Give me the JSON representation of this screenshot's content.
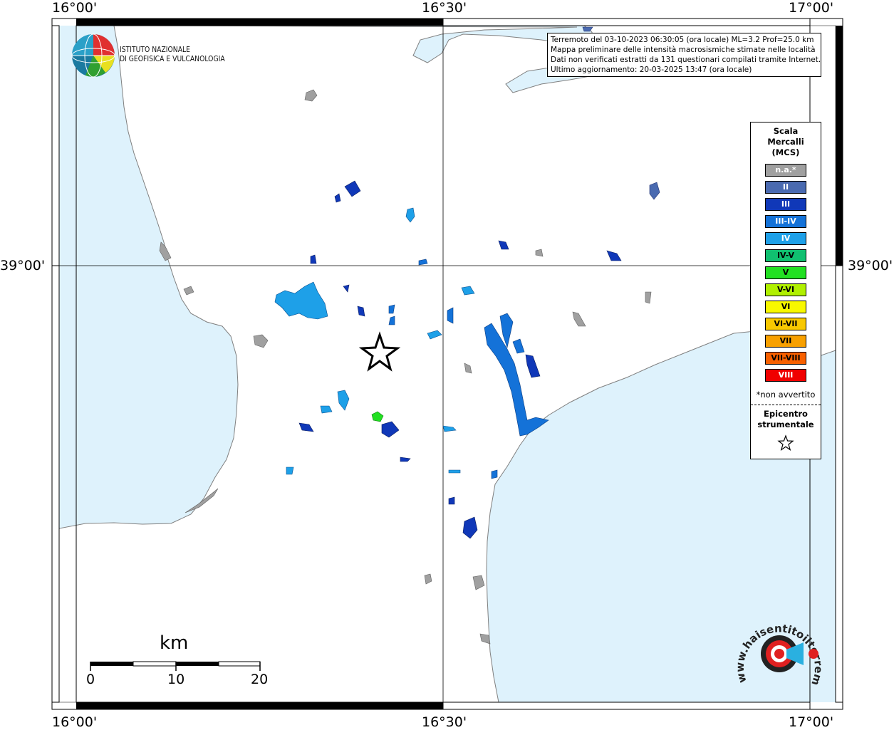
{
  "coords": {
    "top": [
      "16°00'",
      "16°30'",
      "17°00'"
    ],
    "bottom": [
      "16°00'",
      "16°30'",
      "17°00'"
    ],
    "left": "39°00'",
    "right": "39°00'"
  },
  "infobox": {
    "lines": [
      "Terremoto del 03-10-2023 06:30:05 (ora locale) ML=3.2 Prof=25.0 km",
      "Mappa preliminare delle intensità macrosismiche stimate nelle località",
      "Dati non verificati estratti da 131 questionari compilati tramite Internet.",
      "Ultimo aggiornamento: 20-03-2025 13:47 (ora locale)"
    ]
  },
  "ingv": {
    "line1": "ISTITUTO NAZIONALE",
    "line2": "DI GEOFISICA E VULCANOLOGIA"
  },
  "legend": {
    "title": [
      "Scala",
      "Mercalli",
      "(MCS)"
    ],
    "items": [
      {
        "label": "n.a.*",
        "color": "#a0a0a0",
        "dark": false
      },
      {
        "label": "II",
        "color": "#4a6ab0",
        "dark": false
      },
      {
        "label": "III",
        "color": "#1038b8",
        "dark": false
      },
      {
        "label": "III-IV",
        "color": "#1472d8",
        "dark": false
      },
      {
        "label": "IV",
        "color": "#1ea0e8",
        "dark": false
      },
      {
        "label": "IV-V",
        "color": "#10c070",
        "dark": true
      },
      {
        "label": "V",
        "color": "#22e022",
        "dark": true
      },
      {
        "label": "V-VI",
        "color": "#b0f000",
        "dark": true
      },
      {
        "label": "VI",
        "color": "#f8f800",
        "dark": true
      },
      {
        "label": "VI-VII",
        "color": "#f8c800",
        "dark": true
      },
      {
        "label": "VII",
        "color": "#f8a000",
        "dark": true
      },
      {
        "label": "VII-VIII",
        "color": "#f86000",
        "dark": true
      },
      {
        "label": "VIII",
        "color": "#f00000",
        "dark": false
      }
    ],
    "note": "*non avvertito",
    "epicenter": [
      "Epicentro",
      "strumentale"
    ]
  },
  "scale_bar": {
    "unit": "km",
    "ticks": [
      "0",
      "10",
      "20"
    ]
  },
  "hsit": {
    "text": "www.haisentitoilterremoto.it"
  },
  "colors": {
    "sea": "#def2fc",
    "land": "#ffffff",
    "frame": "#000000",
    "na": "#a0a0a0",
    "ii": "#4a6ab0",
    "iii": "#1038b8",
    "iii_iv": "#1472d8",
    "iv": "#1ea0e8",
    "v": "#22e022"
  }
}
